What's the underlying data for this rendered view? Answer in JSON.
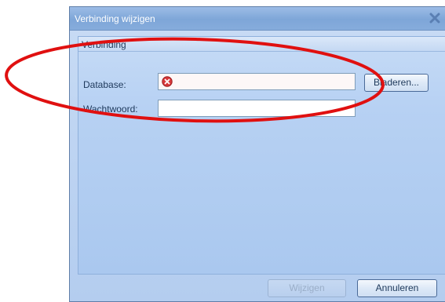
{
  "dialog": {
    "title": "Verbinding wijzigen",
    "close_icon": "close-icon",
    "group": {
      "title": "Verbinding",
      "database_label": "Database:",
      "database_value": "",
      "database_status_icon": "error-icon",
      "browse_label": "Bladeren...",
      "password_label": "Wachtwoord:",
      "password_value": ""
    },
    "ok_label": "Wijzigen",
    "cancel_label": "Annuleren"
  },
  "annotation": {
    "shape": "ellipse",
    "color": "#e01010"
  }
}
